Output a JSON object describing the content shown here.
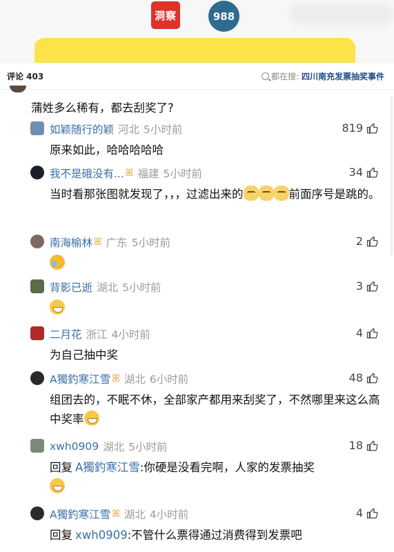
{
  "header": {
    "logo_red_text": "洞察",
    "logo_circle_text": "988",
    "comment_count": "评论 403",
    "search_prefix": "都在搜:",
    "search_term": "四川南充发票抽奖事件"
  },
  "top_comment": {
    "text": "蒲姓多么稀有，都去刮奖了?"
  },
  "replies": [
    {
      "name": "如颖随行的颖",
      "badge": "",
      "location": "河北",
      "time": "5小时前",
      "likes": "819",
      "body": "原来如此，哈哈哈哈哈",
      "avatar_color": "#6f8fb2"
    },
    {
      "name": "我不是硪没有...",
      "badge": "ꕤ",
      "location": "福建",
      "time": "5小时前",
      "likes": "34",
      "body_a": "当时看那张图就发现了，，，过滤出来的",
      "body_b": "前面序号是跳的。",
      "avatar_color": "#1a1f2b"
    },
    {
      "name": "南海榆林",
      "badge": "ꕤ",
      "location": "广东",
      "time": "5小时前",
      "likes": "2",
      "body": "",
      "avatar_color": "#7b6a5d"
    },
    {
      "name": "背影已逝",
      "badge": "",
      "location": "湖北",
      "time": "5小时前",
      "likes": "3",
      "body": "",
      "avatar_color": "#5a6a4a"
    },
    {
      "name": "二月花",
      "badge": "",
      "location": "浙江",
      "time": "4小时前",
      "likes": "4",
      "body": "为自己抽中奖",
      "avatar_color": "#b02a2a"
    },
    {
      "name": "A獨釣寒江雪",
      "badge": "ꕤ",
      "location": "湖北",
      "time": "6小时前",
      "likes": "48",
      "body": "组团去的，不眠不休，全部家产都用来刮奖了，不然哪里来这么高中奖率",
      "avatar_color": "#2a2a2a"
    },
    {
      "name": "xwh0909",
      "badge": "",
      "location": "湖北",
      "time": "5小时前",
      "likes": "18",
      "reply_prefix": "回复",
      "mention": "A獨釣寒江雪",
      "body": ":你硬是没看完啊，人家的发票抽奖",
      "avatar_color": "#7a8a7a"
    },
    {
      "name": "A獨釣寒江雪",
      "badge": "ꕤ",
      "location": "湖北",
      "time": "4小时前",
      "likes": "4",
      "reply_prefix": "回复",
      "mention": "xwh0909",
      "body": ":不管什么票得通过消费得到发票吧",
      "avatar_color": "#2a2a2a"
    }
  ],
  "icons": {
    "thumb": "thumbs-up-icon",
    "search": "search-icon"
  }
}
